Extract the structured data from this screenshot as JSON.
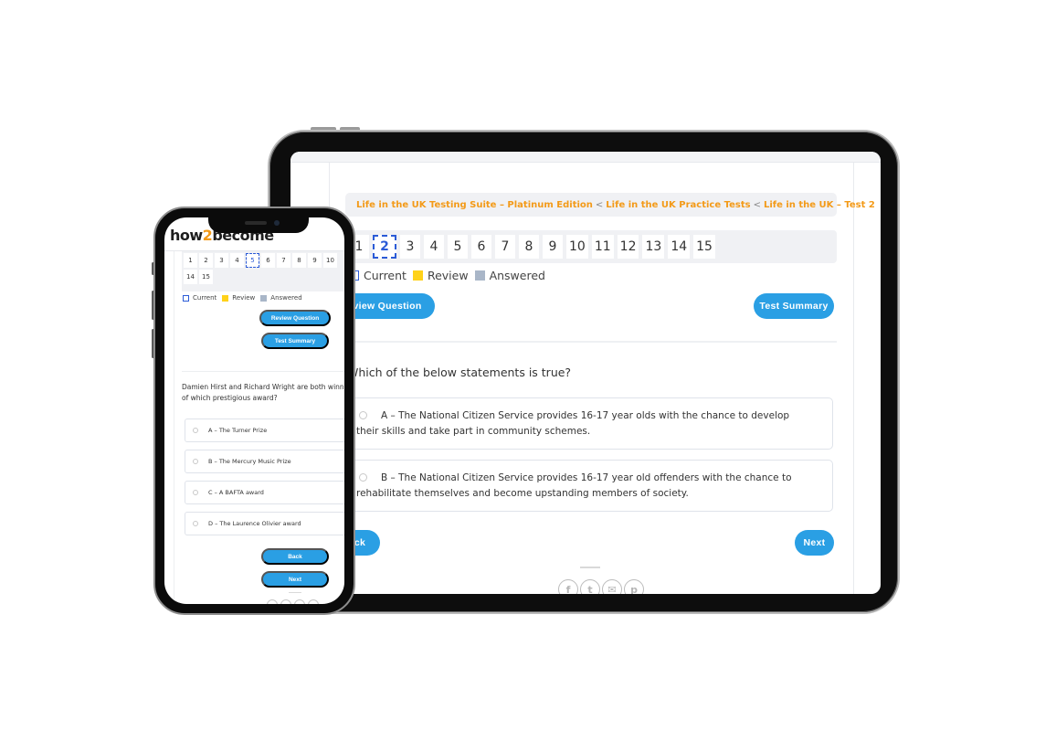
{
  "breadcrumb": {
    "items": [
      "Life in the UK Testing Suite – Platinum Edition",
      "Life in the UK Practice Tests",
      "Life in the UK – Test 2"
    ],
    "separator": "<"
  },
  "tablet": {
    "question_numbers": [
      "1",
      "2",
      "3",
      "4",
      "5",
      "6",
      "7",
      "8",
      "9",
      "10",
      "11",
      "12",
      "13",
      "14",
      "15"
    ],
    "current_question": "2",
    "legend": {
      "current": "Current",
      "review": "Review",
      "answered": "Answered"
    },
    "buttons": {
      "review": "Review Question",
      "summary": "Test Summary",
      "back": "Back",
      "next": "Next"
    },
    "question": "Which of the below statements is true?",
    "options": [
      "A – The National Citizen Service provides 16-17 year olds with the chance to develop their skills and take part in community schemes.",
      "B – The National Citizen Service provides 16-17 year old offenders with the chance to rehabilitate themselves and become upstanding members of society."
    ],
    "socials": [
      "facebook-icon",
      "twitter-icon",
      "email-icon",
      "pinterest-icon"
    ]
  },
  "phone": {
    "logo": {
      "part1": "how",
      "part2": "2",
      "part3": "become"
    },
    "question_numbers": [
      "1",
      "2",
      "3",
      "4",
      "5",
      "6",
      "7",
      "8",
      "9",
      "10",
      "14",
      "15"
    ],
    "current_question": "5",
    "legend": {
      "current": "Current",
      "review": "Review",
      "answered": "Answered"
    },
    "buttons": {
      "review": "Review Question",
      "summary": "Test Summary",
      "back": "Back",
      "next": "Next"
    },
    "question": "Damien Hirst and Richard Wright are both winners of which prestigious award?",
    "options": [
      "A – The Turner Prize",
      "B – The Mercury Music Prize",
      "C – A BAFTA award",
      "D – The Laurence Olivier award"
    ]
  },
  "colors": {
    "accent": "#2a9fe4",
    "breadcrumb": "#f39a18",
    "current": "#2b5bd7",
    "review": "#ffd21a",
    "answered": "#a9b6c8"
  }
}
